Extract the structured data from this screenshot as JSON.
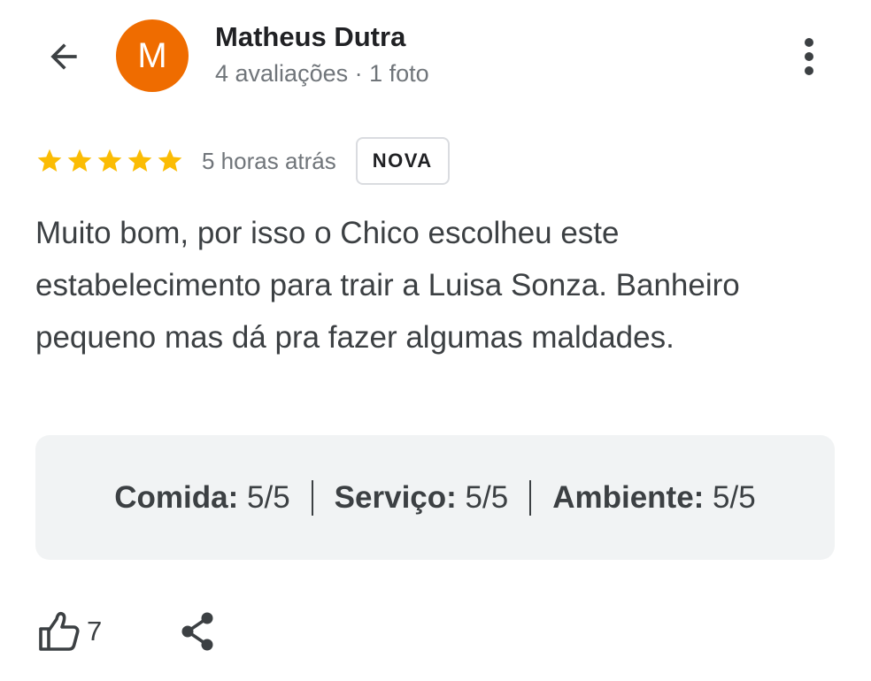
{
  "header": {
    "avatar_letter": "M",
    "reviewer_name": "Matheus Dutra",
    "reviewer_meta": "4 avaliações · 1 foto",
    "back_icon": "arrow-back-icon",
    "menu_icon": "more-vert-icon",
    "avatar_color": "#ef6c00"
  },
  "review": {
    "stars": 5,
    "stars_max": 5,
    "star_color": "#fbbc04",
    "time": "5 horas atrás",
    "badge": "NOVA",
    "text": "Muito bom, por isso o Chico escolheu este estabelecimento para trair a Luisa Sonza. Banheiro pequeno mas dá pra fazer algumas maldades."
  },
  "aspects": [
    {
      "label": "Comida:",
      "value": "5/5"
    },
    {
      "label": "Serviço:",
      "value": "5/5"
    },
    {
      "label": "Ambiente:",
      "value": "5/5"
    }
  ],
  "actions": {
    "like_icon": "thumb-up-icon",
    "like_count": "7",
    "share_icon": "share-icon"
  }
}
